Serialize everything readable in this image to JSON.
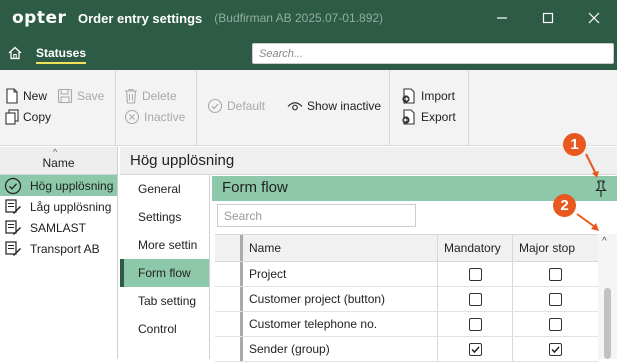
{
  "window": {
    "logo": "opter",
    "title": "Order entry settings",
    "subtitle": "(Budfirman AB 2025.07-01.892)"
  },
  "tabs": {
    "statuses": "Statuses"
  },
  "search": {
    "placeholder": "Search..."
  },
  "toolbar": {
    "new": "New",
    "save": "Save",
    "copy": "Copy",
    "delete": "Delete",
    "inactive": "Inactive",
    "default": "Default",
    "show_inactive": "Show inactive",
    "import": "Import",
    "export": "Export"
  },
  "list": {
    "header": "Name",
    "items": [
      {
        "label": "Hög upplösning",
        "icon": "check-circle-icon",
        "selected": true
      },
      {
        "label": "Låg upplösning",
        "icon": "form-edit-icon"
      },
      {
        "label": "SAMLAST",
        "icon": "form-edit-icon"
      },
      {
        "label": "Transport AB",
        "icon": "form-edit-icon"
      }
    ]
  },
  "detail": {
    "title": "Hög upplösning"
  },
  "subnav": [
    "General",
    "Settings",
    "More settin",
    "Form flow",
    "Tab setting",
    "Control"
  ],
  "subnav_active": "Form flow",
  "form_flow": {
    "title": "Form flow",
    "search_placeholder": "Search",
    "columns": {
      "name": "Name",
      "mandatory": "Mandatory",
      "major_stop": "Major stop"
    },
    "rows": [
      {
        "name": "Project",
        "mandatory": false,
        "major_stop": false
      },
      {
        "name": "Customer project (button)",
        "mandatory": false,
        "major_stop": false
      },
      {
        "name": "Customer telephone no.",
        "mandatory": false,
        "major_stop": false
      },
      {
        "name": "Sender (group)",
        "mandatory": true,
        "major_stop": true
      }
    ]
  },
  "callouts": [
    "1",
    "2"
  ],
  "colors": {
    "brand": "#2e5b46",
    "accent": "#8cc8a9",
    "callout": "#e8581f",
    "tab_underline": "#f0e15a"
  }
}
